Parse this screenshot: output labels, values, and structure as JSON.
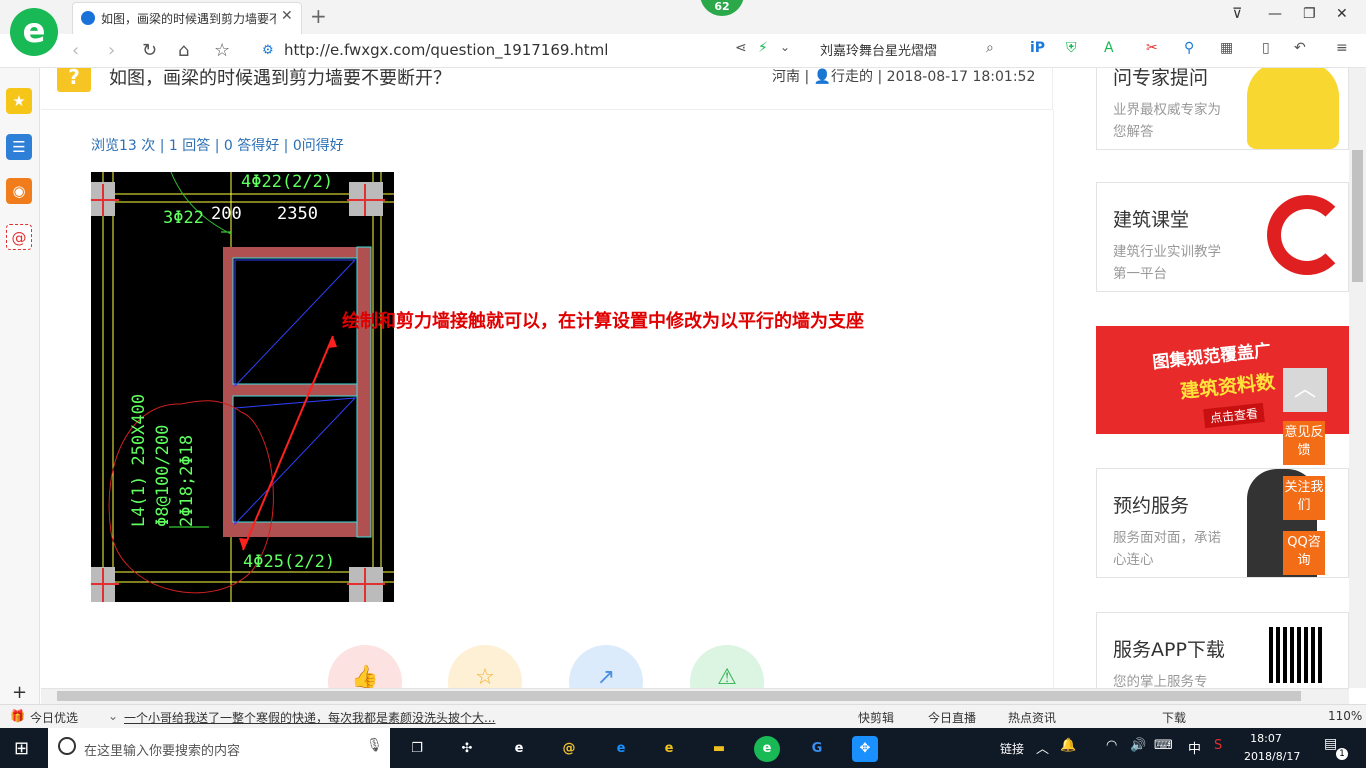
{
  "browser": {
    "logo": "e",
    "tab_title": "如图，画梁的时候遇到剪力墙要不",
    "tab_close": "✕",
    "new_tab": "+",
    "badge": "62",
    "url": "http://e.fwxgx.com/question_1917169.html",
    "search_value": "刘嘉玲舞台星光熠熠"
  },
  "page": {
    "question_icon": "?",
    "question_title": "如图，画梁的时候遇到剪力墙要不要断开？",
    "question_meta": "河南 | 👤行走的 | 2018-08-17 18:01:52",
    "stats": "浏览13 次 | 1 回答 | 0 答得好 | 0问得好",
    "answer": "绘制和剪力墙接触就可以，在计算设置中修改为以平行的墙为支座",
    "cad_labels": {
      "top_rebar": "4Φ22(2/2)",
      "left_rebar": "3Φ22",
      "dim_left": "200",
      "dim_right": "2350",
      "beam_info_1": "L4(1) 250X400",
      "beam_info_2": "Φ8@100/200",
      "beam_info_3": "2Φ18;2Φ18",
      "bottom_rebar": "4Φ25(2/2)"
    }
  },
  "right_panel": {
    "cards": [
      {
        "title": "问专家提问",
        "desc": "业界最权威专家为您解答"
      },
      {
        "title": "建筑课堂",
        "desc": "建筑行业实训教学第一平台"
      },
      {
        "title": "预约服务",
        "desc": "服务面对面，承诺心连心"
      },
      {
        "title": "服务APP下载",
        "desc": "您的掌上服务专"
      }
    ],
    "ad": {
      "line1": "图集规范覆盖广",
      "line2": "建筑资料数",
      "button": "点击查看"
    },
    "float_buttons": [
      "意见反馈",
      "关注我们",
      "QQ咨询"
    ]
  },
  "status_bar": {
    "daily": "今日优选",
    "news": "一个小哥给我送了一整个寒假的快递，每次我都是素颜没洗头披个大...",
    "items": [
      "快剪辑",
      "今日直播",
      "热点资讯",
      "下载"
    ],
    "zoom": "110%"
  },
  "taskbar": {
    "search_placeholder": "在这里输入你要搜索的内容",
    "link_label": "链接",
    "ime": "中",
    "time": "18:07",
    "date": "2018/8/17",
    "notif": "1"
  },
  "colors": {
    "accent": "#19b955",
    "answer_red": "#e00000",
    "link_blue": "#2b6fb5",
    "float_orange": "#f26d16"
  }
}
